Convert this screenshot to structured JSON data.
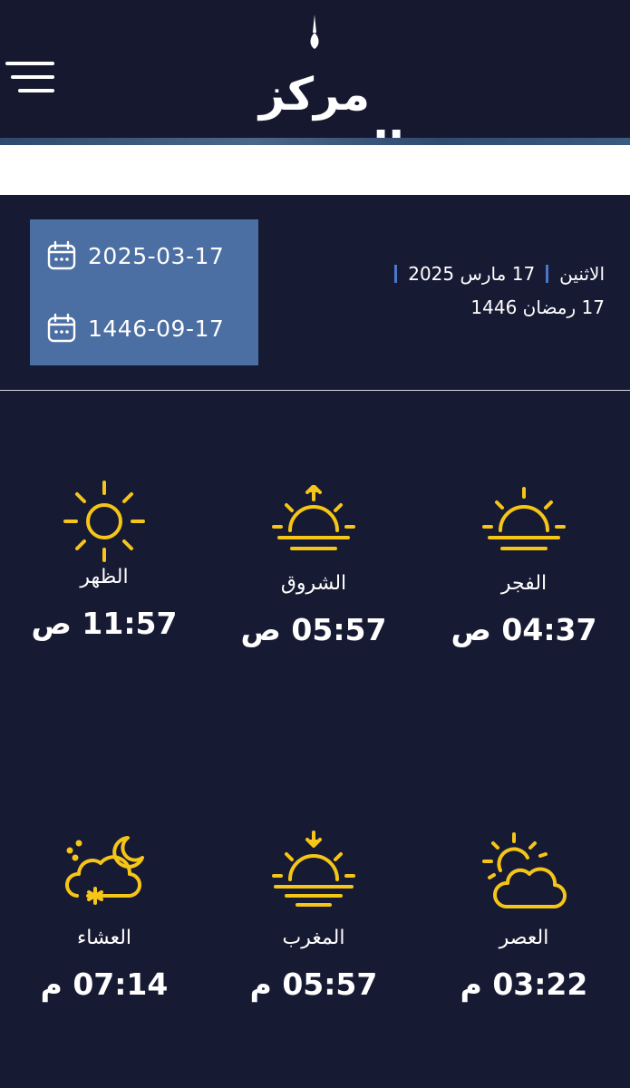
{
  "header": {
    "logo_text": "مركز العجيري"
  },
  "dates": {
    "gregorian_numeric": "2025-03-17",
    "hijri_numeric": "1446-09-17",
    "day_name": "الاثنين",
    "gregorian_text": "17 مارس 2025",
    "hijri_text": "17 رمضان 1446"
  },
  "prayers": [
    {
      "id": "fajr",
      "name": "الفجر",
      "time": "04:37 ص",
      "icon": "sunrise-icon"
    },
    {
      "id": "shurooq",
      "name": "الشروق",
      "time": "05:57 ص",
      "icon": "sun-rising-arrow-icon"
    },
    {
      "id": "dhuhr",
      "name": "الظهر",
      "time": "11:57 ص",
      "icon": "sun-icon"
    },
    {
      "id": "asr",
      "name": "العصر",
      "time": "03:22 م",
      "icon": "sun-cloud-icon"
    },
    {
      "id": "maghrib",
      "name": "المغرب",
      "time": "05:57 م",
      "icon": "sunset-arrow-icon"
    },
    {
      "id": "isha",
      "name": "العشاء",
      "time": "07:14 م",
      "icon": "moon-cloud-icon"
    }
  ],
  "colors": {
    "background": "#171a33",
    "accent": "#f5c518",
    "date_box": "#4b6ea3"
  }
}
